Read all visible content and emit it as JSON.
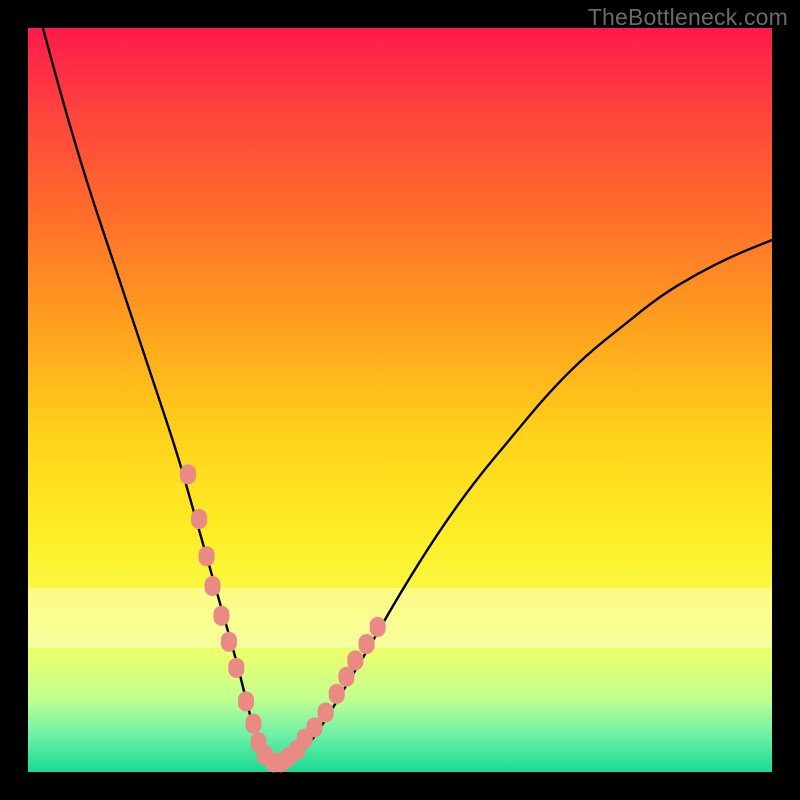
{
  "watermark": "TheBottleneck.com",
  "chart_data": {
    "type": "line",
    "title": "",
    "xlabel": "",
    "ylabel": "",
    "xlim": [
      0,
      100
    ],
    "ylim": [
      0,
      100
    ],
    "series": [
      {
        "name": "bottleneck-curve",
        "x": [
          2,
          5,
          8,
          11,
          14,
          17,
          20,
          22,
          24,
          26,
          28,
          29,
          30,
          31,
          32,
          33,
          34,
          36,
          38,
          40,
          43,
          46,
          50,
          55,
          60,
          65,
          70,
          75,
          80,
          85,
          90,
          95,
          100
        ],
        "y": [
          100,
          89,
          79,
          70,
          61,
          52,
          43,
          36,
          29,
          22,
          15,
          11,
          7,
          4,
          2,
          1,
          1,
          2,
          4,
          7,
          12,
          17,
          24,
          32,
          39,
          45,
          51,
          56,
          60,
          64,
          67,
          69.5,
          71.5
        ]
      }
    ],
    "markers": {
      "name": "highlight-points",
      "color": "#e98b84",
      "x": [
        21.5,
        23,
        24,
        24.8,
        26,
        27,
        28,
        29.3,
        30.3,
        31,
        31.8,
        33,
        34,
        35,
        36.2,
        37.2,
        38.5,
        40,
        41.5,
        42.8,
        44,
        45.5,
        47
      ],
      "y": [
        40,
        34,
        29,
        25,
        21,
        17.5,
        14,
        9.5,
        6.5,
        4,
        2.3,
        1.3,
        1.3,
        2,
        3,
        4.5,
        6,
        8,
        10.5,
        12.8,
        15,
        17.2,
        19.5
      ]
    }
  }
}
